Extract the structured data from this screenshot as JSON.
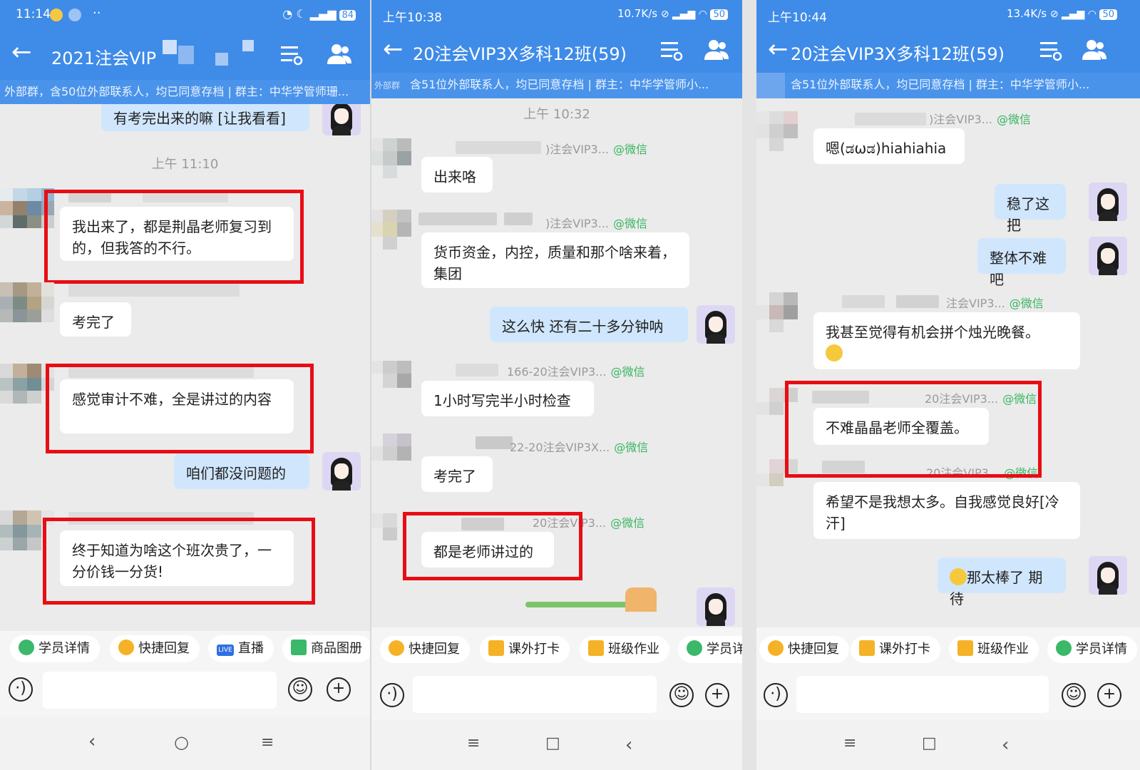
{
  "panels": [
    {
      "status_time": "11:14",
      "status_right": "84",
      "title": "2021注会VIP",
      "subtitle": "外部群，含50位外部联系人，均已同意存档 | 群主：中华学管师珊...",
      "partial_top_message": "有考完出来的嘛 [让我看看]",
      "timestamp": "上午 11:10",
      "messages": [
        {
          "text": "我出来了，都是荆晶老师复习到的，但我答的不行。"
        },
        {
          "text": "考完了"
        },
        {
          "text": "感觉审计不难，全是讲过的内容"
        },
        {
          "text": "咱们都没问题的"
        },
        {
          "text": "终于知道为啥这个班次贵了，一分价钱一分货!"
        }
      ],
      "toolbar": [
        "学员详情",
        "快捷回复",
        "直播",
        "商品图册"
      ],
      "live_badge": "LIVE"
    },
    {
      "status_time": "上午10:38",
      "status_right": "10.7K/s",
      "status_battery": "50",
      "title": "20注会VIP3X多科12班(59)",
      "subtitle_prefix": "外部群",
      "subtitle": "含51位外部联系人，均已同意存档 | 群主：中华学管师小...",
      "timestamp": "上午 10:32",
      "messages": [
        {
          "sender": ")注会VIP3...",
          "tag": "@微信",
          "text": "出来咯"
        },
        {
          "sender": ")注会VIP3...",
          "tag": "@微信",
          "text": "货币资金，内控，质量和那个啥来着，集团"
        },
        {
          "text": "这么快 还有二十多分钟呐"
        },
        {
          "sender": "166-20注会VIP3...",
          "tag": "@微信",
          "text": "1小时写完半小时检查"
        },
        {
          "sender": "22-20注会VIP3X...",
          "tag": "@微信",
          "text": "考完了"
        },
        {
          "sender": "20注会VIP3...",
          "tag": "@微信",
          "text": "都是老师讲过的"
        }
      ],
      "toolbar": [
        "快捷回复",
        "课外打卡",
        "班级作业",
        "学员详"
      ]
    },
    {
      "status_time": "上午10:44",
      "status_right": "13.4K/s",
      "status_battery": "50",
      "title": "20注会VIP3X多科12班(59)",
      "subtitle": "含51位外部联系人，均已同意存档 | 群主：中华学管师小...",
      "messages": [
        {
          "sender": ")注会VIP3...",
          "tag": "@微信",
          "text": "嗯(ಡωಡ)hiahiahia"
        },
        {
          "text": "稳了这把"
        },
        {
          "text": "整体不难吧"
        },
        {
          "sender": "注会VIP3...",
          "tag": "@微信",
          "text": "我甚至觉得有机会拼个烛光晚餐。"
        },
        {
          "sender": "20注会VIP3...",
          "tag": "@微信",
          "text": "不难晶晶老师全覆盖。"
        },
        {
          "sender": "20注会VIP3...",
          "tag": "@微信",
          "text": "希望不是我想太多。自我感觉良好[冷汗]"
        },
        {
          "text": "那太棒了 期待"
        }
      ],
      "toolbar": [
        "快捷回复",
        "课外打卡",
        "班级作业",
        "学员详情"
      ]
    }
  ]
}
